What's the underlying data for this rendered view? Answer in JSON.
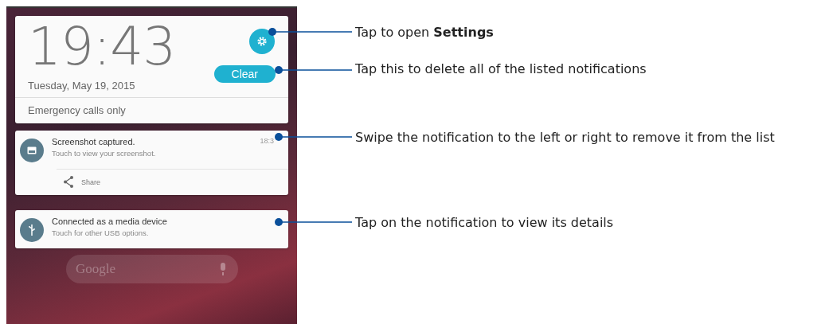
{
  "lock_screen": {
    "clock": "19:43",
    "date": "Tuesday, May 19, 2015",
    "clear_button": "Clear",
    "status": "Emergency calls only"
  },
  "notifications": [
    {
      "kind": "screenshot",
      "title": "Screenshot captured.",
      "text": "Touch to view your screenshot.",
      "time": "18:3",
      "action": "Share"
    },
    {
      "kind": "usb",
      "title": "Connected as a media device",
      "text": "Touch for other USB options."
    }
  ],
  "search_bar": {
    "placeholder": "Google"
  },
  "callouts": [
    {
      "text": "Tap to open **Settings**"
    },
    {
      "text": "Tap this to delete all of the listed notifications"
    },
    {
      "text": "Swipe the notification to the left or right to remove it from the list"
    },
    {
      "text": "Tap on the notification to view its details"
    }
  ]
}
